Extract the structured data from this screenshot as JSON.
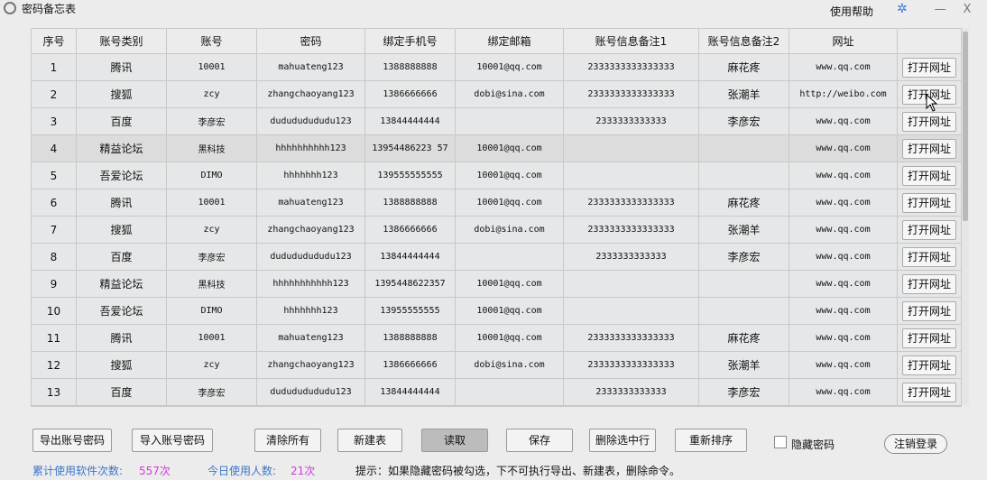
{
  "window": {
    "title": "密码备忘表",
    "help": "使用帮助",
    "min_label": "—",
    "close_label": "X"
  },
  "table": {
    "headers": [
      "序号",
      "账号类别",
      "账号",
      "密码",
      "绑定手机号",
      "绑定邮箱",
      "账号信息备注1",
      "账号信息备注2",
      "网址",
      ""
    ],
    "open_label": "打开网址",
    "rows": [
      [
        "1",
        "腾讯",
        "10001",
        "mahuateng123",
        "1388888888",
        "10001@qq.com",
        "2333333333333333",
        "麻花疼",
        "www.qq.com"
      ],
      [
        "2",
        "搜狐",
        "zcy",
        "zhangchaoyang123",
        "1386666666",
        "dobi@sina.com",
        "2333333333333333",
        "张潮羊",
        "http://weibo.com"
      ],
      [
        "3",
        "百度",
        "李彦宏",
        "dudududududu123",
        "13844444444",
        "",
        "2333333333333",
        "李彦宏",
        "www.qq.com"
      ],
      [
        "4",
        "精益论坛",
        "黑科技",
        "hhhhhhhhhh123",
        "13954486223 57",
        "10001@qq.com",
        "",
        "",
        "www.qq.com"
      ],
      [
        "5",
        "吾爱论坛",
        "DIMO",
        "hhhhhhh123",
        "139555555555",
        "10001@qq.com",
        "",
        "",
        "www.qq.com"
      ],
      [
        "6",
        "腾讯",
        "10001",
        "mahuateng123",
        "1388888888",
        "10001@qq.com",
        "2333333333333333",
        "麻花疼",
        "www.qq.com"
      ],
      [
        "7",
        "搜狐",
        "zcy",
        "zhangchaoyang123",
        "1386666666",
        "dobi@sina.com",
        "2333333333333333",
        "张潮羊",
        "www.qq.com"
      ],
      [
        "8",
        "百度",
        "李彦宏",
        "dudududududu123",
        "13844444444",
        "",
        "2333333333333",
        "李彦宏",
        "www.qq.com"
      ],
      [
        "9",
        "精益论坛",
        "黑科技",
        "hhhhhhhhhhh123",
        "1395448622357",
        "10001@qq.com",
        "",
        "",
        "www.qq.com"
      ],
      [
        "10",
        "吾爱论坛",
        "DIMO",
        "hhhhhhh123",
        "13955555555",
        "10001@qq.com",
        "",
        "",
        "www.qq.com"
      ],
      [
        "11",
        "腾讯",
        "10001",
        "mahuateng123",
        "1388888888",
        "10001@qq.com",
        "2333333333333333",
        "麻花疼",
        "www.qq.com"
      ],
      [
        "12",
        "搜狐",
        "zcy",
        "zhangchaoyang123",
        "1386666666",
        "dobi@sina.com",
        "2333333333333333",
        "张潮羊",
        "www.qq.com"
      ],
      [
        "13",
        "百度",
        "李彦宏",
        "dudududududu123",
        "13844444444",
        "",
        "2333333333333",
        "李彦宏",
        "www.qq.com"
      ]
    ],
    "selected_row": 3
  },
  "buttons": {
    "export": "导出账号密码",
    "import": "导入账号密码",
    "clear": "清除所有",
    "new": "新建表",
    "read": "读取",
    "save": "保存",
    "delete": "删除选中行",
    "resort": "重新排序",
    "logout": "注销登录"
  },
  "hide_password": {
    "label": "隐藏密码",
    "checked": false
  },
  "status": {
    "total_label": "累计使用软件次数:",
    "total_value": "557次",
    "today_label": "今日使用人数:",
    "today_value": "21次",
    "hint": "提示：如果隐藏密码被勾选，下不可执行导出、新建表，删除命令。"
  },
  "colors": {
    "accent": "#3a76c9",
    "count": "#d13adf"
  }
}
